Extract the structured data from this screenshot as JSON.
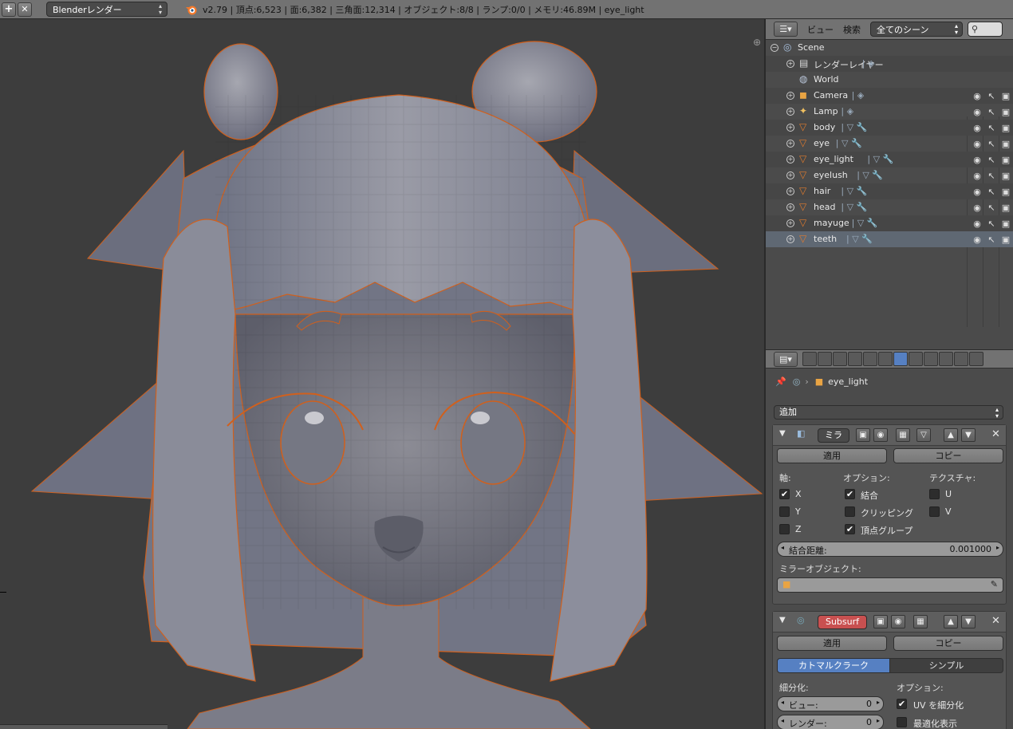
{
  "topbar": {
    "plus": "+",
    "close": "✕",
    "engine": "Blenderレンダー",
    "stats": "v2.79 | 頂点:6,523 | 面:6,382 | 三角面:12,314 | オブジェクト:8/8 | ランプ:0/0 | メモリ:46.89M | eye_light"
  },
  "outliner": {
    "view": "ビュー",
    "search": "検索",
    "scenes": "全てのシーン",
    "rows": [
      {
        "label": "Scene",
        "icon": "scene-icon"
      },
      {
        "label": "レンダーレイヤー",
        "icon": "render-layers-icon"
      },
      {
        "label": "World",
        "icon": "world-icon"
      },
      {
        "label": "Camera",
        "icon": "camera-icon"
      },
      {
        "label": "Lamp",
        "icon": "lamp-icon"
      },
      {
        "label": "body",
        "icon": "mesh-icon"
      },
      {
        "label": "eye",
        "icon": "mesh-icon"
      },
      {
        "label": "eye_light",
        "icon": "mesh-icon"
      },
      {
        "label": "eyelush",
        "icon": "mesh-icon"
      },
      {
        "label": "hair",
        "icon": "mesh-icon"
      },
      {
        "label": "head",
        "icon": "mesh-icon"
      },
      {
        "label": "mayuge",
        "icon": "mesh-icon"
      },
      {
        "label": "teeth",
        "icon": "mesh-icon"
      }
    ],
    "selected_color": "#5f6873",
    "object_color": "#e07b2e"
  },
  "properties": {
    "object_name": "eye_light",
    "add_modifier": "追加",
    "mirror": {
      "name": "ミラ",
      "apply": "適用",
      "copy": "コピー",
      "axis_label": "軸:",
      "options_label": "オプション:",
      "texture_label": "テクスチャ:",
      "x": "X",
      "y": "Y",
      "z": "Z",
      "merge": "結合",
      "clipping": "クリッピング",
      "vertex_groups": "頂点グループ",
      "u": "U",
      "v": "V",
      "merge_distance_label": "結合距離:",
      "merge_distance_value": "0.001000",
      "mirror_object_label": "ミラーオブジェクト:"
    },
    "subsurf": {
      "name": "Subsurf",
      "apply": "適用",
      "copy": "コピー",
      "catmull": "カトマルクラーク",
      "simple": "シンプル",
      "subdivisions_label": "細分化:",
      "options_label": "オプション:",
      "view_label": "ビュー:",
      "view_value": "0",
      "render_label": "レンダー:",
      "render_value": "0",
      "subdivide_uv": "UV を細分化",
      "optimal_display": "最適化表示"
    },
    "accent_color": "#5680c2",
    "modifier_name_red": "#c85050"
  }
}
